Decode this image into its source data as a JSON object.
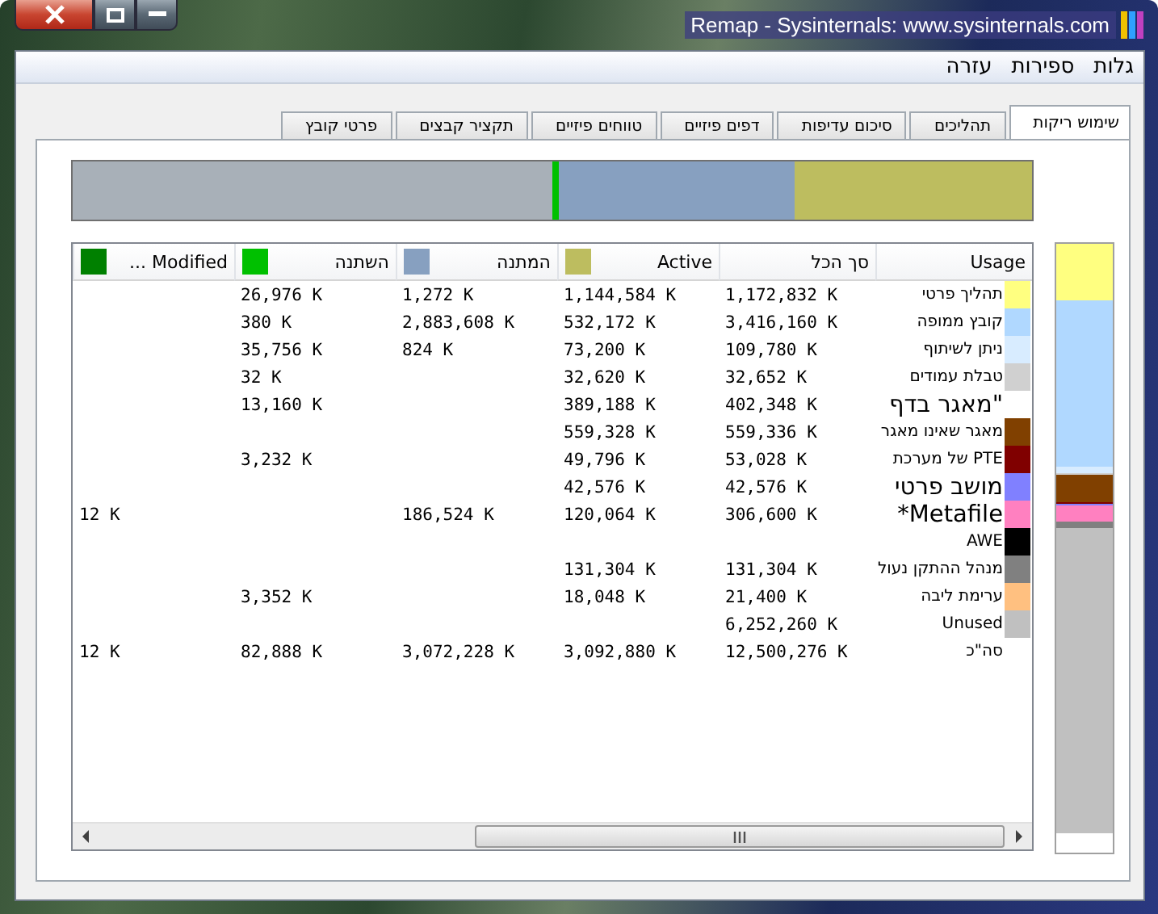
{
  "window": {
    "title": "Remap - Sysinternals: www.sysinternals.com"
  },
  "menu": [
    "גלות",
    "ספירות",
    "עזרה"
  ],
  "tabs": [
    {
      "label": "שימוש ריקות",
      "selected": true
    },
    {
      "label": "תהליכים",
      "selected": false
    },
    {
      "label": "סיכום עדיפות",
      "selected": false
    },
    {
      "label": "דפים פיזיים",
      "selected": false
    },
    {
      "label": "טווחים פיזיים",
      "selected": false
    },
    {
      "label": "תקציר קבצים",
      "selected": false
    },
    {
      "label": "פרטי קובץ",
      "selected": false
    }
  ],
  "table": {
    "columns": [
      {
        "label": "Usage"
      },
      {
        "label": "סך הכל"
      },
      {
        "label": "Active",
        "color": "#bdbd5f"
      },
      {
        "label": "המתנה",
        "color": "#87a0c0"
      },
      {
        "label": "השתנה",
        "color": "#00c000"
      },
      {
        "label": "Modified ...",
        "color": "#008000"
      }
    ],
    "rows": [
      {
        "kind": "normal",
        "usage": "תהליך פרטי",
        "color": "#ffff80",
        "total": "1,172,832 K",
        "active": "1,144,584 K",
        "standby": "1,272 K",
        "modified": "26,976 K"
      },
      {
        "kind": "normal",
        "usage": "קובץ ממופה",
        "color": "#b0d8ff",
        "total": "3,416,160 K",
        "active": "532,172 K",
        "standby": "2,883,608 K",
        "modified": "380 K"
      },
      {
        "kind": "normal",
        "usage": "ניתן לשיתוף",
        "color": "#d8ecff",
        "total": "109,780 K",
        "active": "73,200 K",
        "standby": "824 K",
        "modified": "35,756 K"
      },
      {
        "kind": "normal",
        "usage": "טבלת עמודים",
        "color": "#d0d0d0",
        "total": "32,652 K",
        "active": "32,620 K",
        "modified": "32 K"
      },
      {
        "kind": "large",
        "usage": "\"מאגר בדף",
        "total": "402,348 K",
        "active": "389,188 K",
        "modified": "13,160 K"
      },
      {
        "kind": "normal",
        "usage": "מאגר שאינו מאגר",
        "color": "#804000",
        "total": "559,336 K",
        "active": "559,328 K"
      },
      {
        "kind": "normal",
        "usage": "PTE של מערכת",
        "color": "#800000",
        "total": "53,028 K",
        "active": "49,796 K",
        "modified": "3,232 K"
      },
      {
        "kind": "large",
        "usage": "מושב פרטי",
        "color": "#8080ff",
        "total": "42,576 K",
        "active": "42,576 K"
      },
      {
        "kind": "large",
        "usage": "Metafile*",
        "color": "#ff80c0",
        "total": "306,600 K",
        "active": "120,064 K",
        "standby": "186,524 K",
        "modified_no_write": "12 K"
      },
      {
        "kind": "normal",
        "usage": "AWE",
        "color": "#000000"
      },
      {
        "kind": "normal",
        "usage": "מנהל ההתקן נעול",
        "color": "#808080",
        "total": "131,304 K",
        "active": "131,304 K"
      },
      {
        "kind": "normal",
        "usage": "ערימת ליבה",
        "color": "#ffc080",
        "total": "21,400 K",
        "active": "18,048 K",
        "modified": "3,352 K"
      },
      {
        "kind": "normal",
        "usage": "Unused",
        "color": "#c0c0c0",
        "total": "6,252,260 K"
      },
      {
        "kind": "normal",
        "usage": "סה\"כ",
        "total": "12,500,276 K",
        "active": "3,092,880 K",
        "standby": "3,072,228 K",
        "modified": "82,888 K",
        "modified_no_write": "12 K"
      }
    ]
  }
}
